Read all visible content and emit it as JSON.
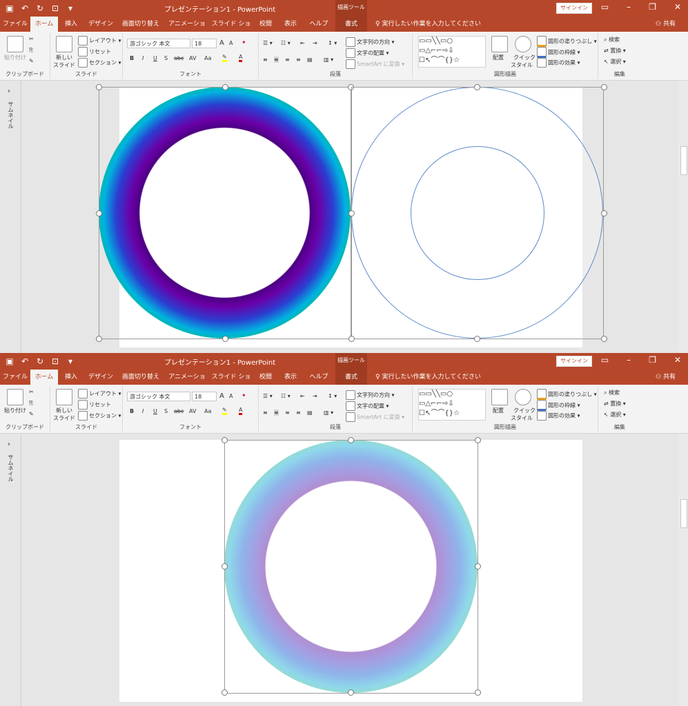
{
  "app": {
    "doc_title": "プレゼンテーション1 - PowerPoint",
    "context_tools": "描画ツール",
    "signin": "サインイン",
    "share": "共有",
    "tell_me": "実行したい作業を入力してください"
  },
  "tabs": [
    "ファイル",
    "ホーム",
    "挿入",
    "デザイン",
    "画面切り替え",
    "アニメーション",
    "スライド ショー",
    "校閲",
    "表示",
    "ヘルプ",
    "書式"
  ],
  "active_tab": "ホーム",
  "ribbon": {
    "clipboard": {
      "paste": "貼り付け",
      "label": "クリップボード"
    },
    "slides": {
      "new_slide_1": "新しい",
      "new_slide_2": "スライド",
      "layout": "レイアウト",
      "reset": "リセット",
      "section": "セクション",
      "label": "スライド"
    },
    "font": {
      "font_name": "游ゴシック 本文",
      "font_size": "18",
      "bold": "B",
      "italic": "I",
      "underline": "U",
      "shadow": "S",
      "strike": "abc",
      "spacing": "AV",
      "case": "Aa",
      "grow": "A",
      "shrink": "A",
      "label": "フォント"
    },
    "paragraph": {
      "text_direction": "文字列の方向",
      "align_text": "文字の配置",
      "smartart": "SmartArt に変換",
      "label": "段落"
    },
    "drawing": {
      "arrange": "配置",
      "quick_styles_1": "クイック",
      "quick_styles_2": "スタイル",
      "fill": "図形の塗りつぶし",
      "outline": "図形の枠線",
      "effects": "図形の効果",
      "label": "図形描画"
    },
    "editing": {
      "find": "検索",
      "replace": "置換",
      "select": "選択",
      "label": "編集"
    }
  },
  "left_pane": {
    "label": "サムネイル"
  },
  "colors": {
    "brand": "#b7472a",
    "brand_dark": "#a03c22",
    "ribbon_bg": "#f3f3f3",
    "selection_outline": "#5b8ac9"
  }
}
